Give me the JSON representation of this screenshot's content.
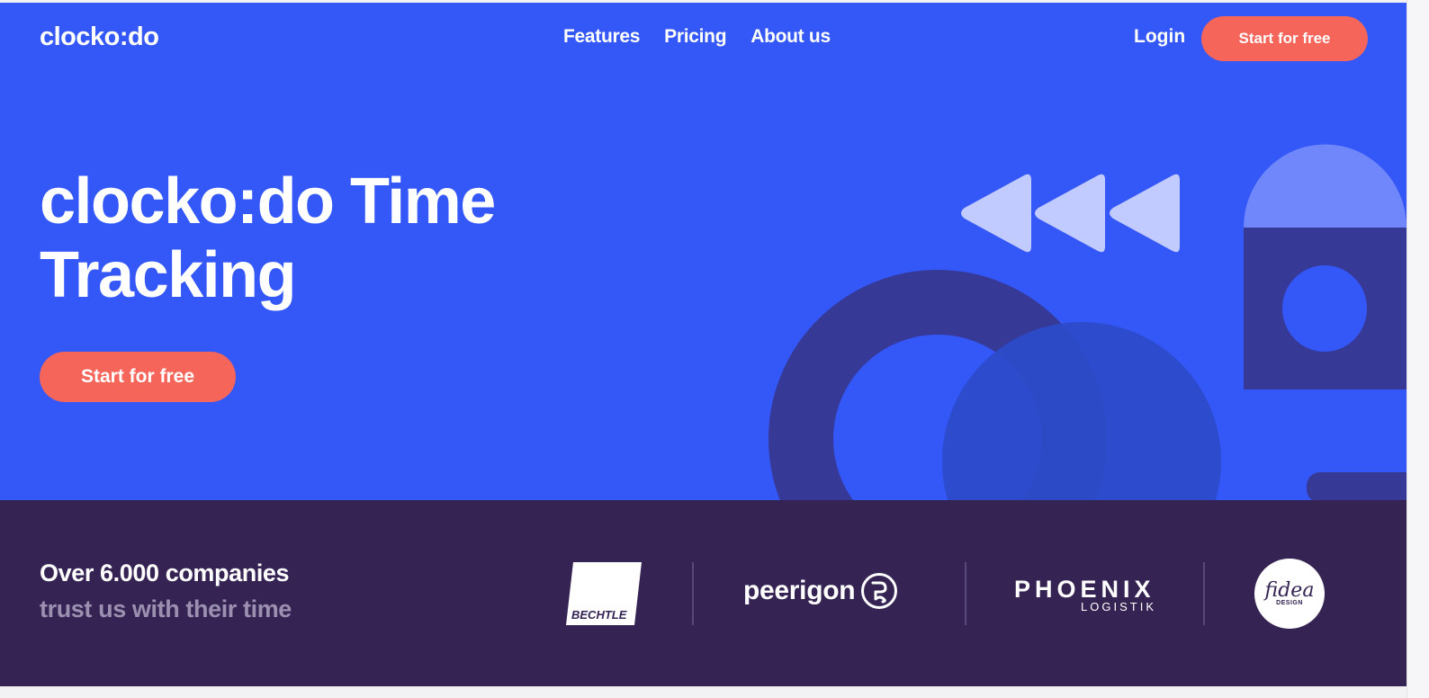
{
  "header": {
    "logo": "clocko:do",
    "nav": [
      {
        "label": "Features"
      },
      {
        "label": "Pricing"
      },
      {
        "label": "About us"
      }
    ],
    "login_label": "Login",
    "cta_label": "Start for free"
  },
  "hero": {
    "title": "clocko:do Time Tracking",
    "cta_label": "Start for free",
    "decorations": [
      "rewind-icon",
      "ring-shape",
      "circle-shape",
      "arch-shape",
      "pill-shape"
    ]
  },
  "trust": {
    "line1": "Over 6.000 companies",
    "line2": "trust us with their time",
    "logos": [
      {
        "name": "BECHTLE"
      },
      {
        "name": "peerigon"
      },
      {
        "name": "PHOENIX",
        "subtitle": "LOGISTIK"
      },
      {
        "name": "fidea",
        "subtitle": "DESIGN"
      }
    ]
  },
  "colors": {
    "hero_bg": "#3457f7",
    "trust_bg": "#352354",
    "cta": "#f5655a",
    "muted_text": "#9b90b0"
  }
}
